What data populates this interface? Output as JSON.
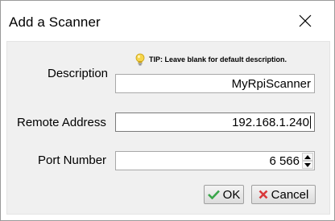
{
  "window": {
    "title": "Add a Scanner"
  },
  "tip": {
    "text": "TIP: Leave blank for default description.",
    "icon": "lightbulb-icon"
  },
  "form": {
    "description": {
      "label": "Description",
      "value": "MyRpiScanner"
    },
    "remote_address": {
      "label": "Remote Address",
      "value": "192.168.1.240"
    },
    "port_number": {
      "label": "Port Number",
      "value": "6 566"
    }
  },
  "buttons": {
    "ok": {
      "label": "OK",
      "icon": "checkmark-icon",
      "icon_color": "#3aa64a"
    },
    "cancel": {
      "label": "Cancel",
      "icon": "x-mark-icon",
      "icon_color": "#d9383a"
    }
  }
}
